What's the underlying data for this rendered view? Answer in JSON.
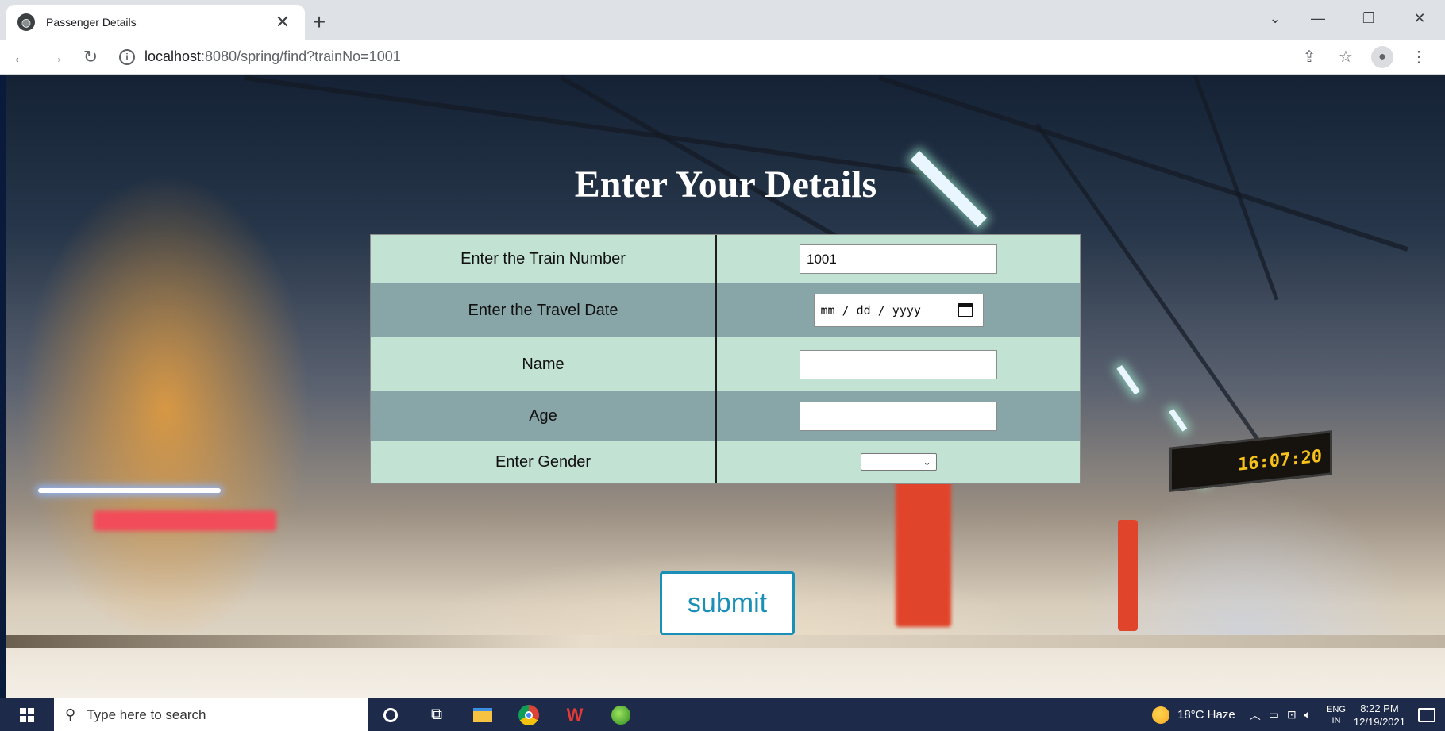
{
  "browser": {
    "tab_title": "Passenger Details",
    "tab_close": "✕",
    "new_tab": "+",
    "url_host": "localhost",
    "url_rest": ":8080/spring/find?trainNo=1001"
  },
  "page": {
    "title": "Enter Your Details",
    "form": {
      "train_number_label": "Enter the Train Number",
      "train_number_value": "1001",
      "travel_date_label": "Enter the Travel Date",
      "travel_date_value": "mm / dd / yyyy",
      "name_label": "Name",
      "name_value": "",
      "age_label": "Age",
      "age_value": "",
      "gender_label": "Enter Gender",
      "gender_value": ""
    },
    "submit_label": "submit",
    "departure_board_time": "16:07:20"
  },
  "taskbar": {
    "search_placeholder": "Type here to search",
    "weather": "18°C  Haze",
    "lang_top": "ENG",
    "lang_bottom": "IN",
    "time": "8:22 PM",
    "date": "12/19/2021"
  },
  "colors": {
    "row_light": "#c2e2d4",
    "row_dark": "#88a6a8",
    "submit_accent": "#1a8fb8"
  }
}
